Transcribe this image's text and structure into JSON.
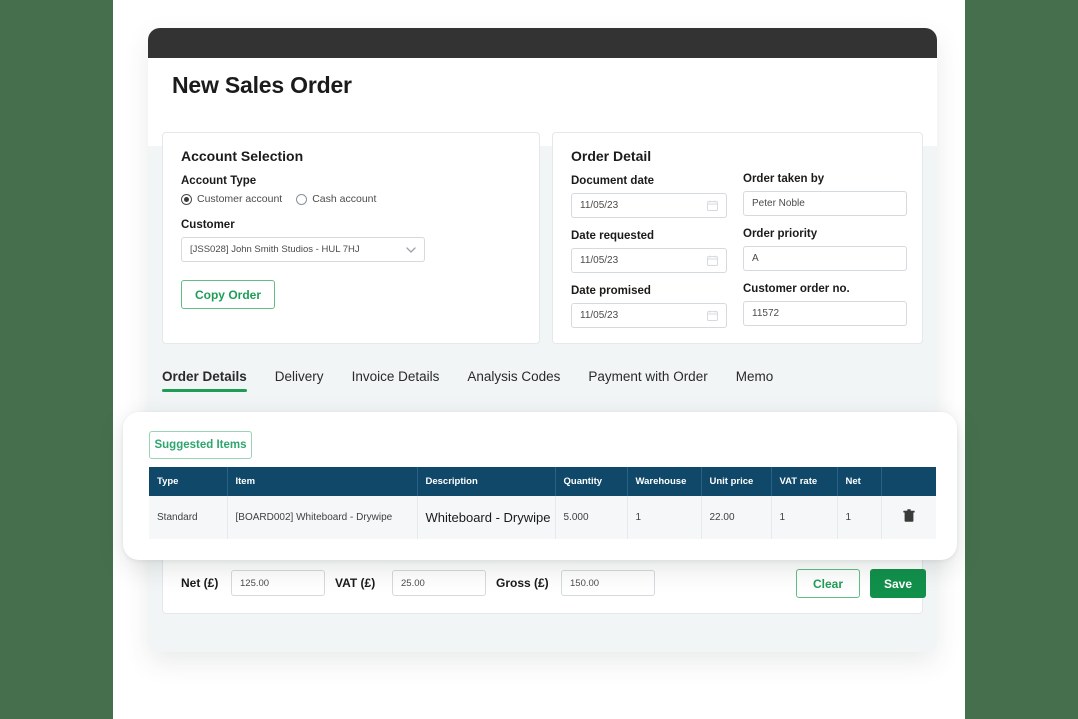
{
  "page": {
    "title": "New Sales Order",
    "brand_green": "#46704d",
    "accent_green": "#1f9d57",
    "table_header_blue": "#104869",
    "topbar_color": "#333333"
  },
  "account_selection": {
    "title": "Account Selection",
    "account_type_label": "Account Type",
    "radios": [
      {
        "label": "Customer account",
        "selected": true
      },
      {
        "label": "Cash account",
        "selected": false
      }
    ],
    "customer_label": "Customer",
    "customer_value": "[JSS028] John Smith Studios - HUL 7HJ",
    "copy_order_label": "Copy Order"
  },
  "order_detail": {
    "title": "Order Detail",
    "fields": [
      {
        "label": "Document date",
        "value": "11/05/23",
        "icon": "calendar-icon"
      },
      {
        "label": "Date requested",
        "value": "11/05/23",
        "icon": "calendar-icon"
      },
      {
        "label": "Date promised",
        "value": "11/05/23",
        "icon": "calendar-icon"
      },
      {
        "label": "Order taken by",
        "value": "Peter Noble",
        "icon": null
      },
      {
        "label": "Order priority",
        "value": "A",
        "icon": null
      },
      {
        "label": "Customer order no.",
        "value": "11572",
        "icon": null
      }
    ]
  },
  "tabs": [
    {
      "label": "Order Details",
      "active": true
    },
    {
      "label": "Delivery",
      "active": false
    },
    {
      "label": "Invoice Details",
      "active": false
    },
    {
      "label": "Analysis Codes",
      "active": false
    },
    {
      "label": "Payment with Order",
      "active": false
    },
    {
      "label": "Memo",
      "active": false
    }
  ],
  "items_panel": {
    "suggested_items_label": "Suggested Items",
    "columns": [
      "Type",
      "Item",
      "Description",
      "Quantity",
      "Warehouse",
      "Unit price",
      "VAT rate",
      "Net",
      ""
    ],
    "rows": [
      {
        "type": "Standard",
        "item": "[BOARD002] Whiteboard - Drywipe",
        "description": "Whiteboard - Drywipe",
        "quantity": "5.000",
        "warehouse": "1",
        "unit_price": "22.00",
        "vat_rate": "1",
        "net": "1",
        "delete_icon": "trash-icon"
      }
    ]
  },
  "totals": {
    "net_label": "Net (£)",
    "net_value": "125.00",
    "vat_label": "VAT (£)",
    "vat_value": "25.00",
    "gross_label": "Gross (£)",
    "gross_value": "150.00",
    "clear_label": "Clear",
    "save_label": "Save"
  }
}
